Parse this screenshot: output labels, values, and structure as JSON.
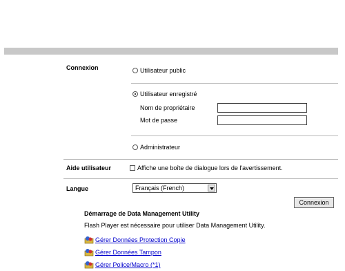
{
  "login": {
    "section_label": "Connexion",
    "public_user_label": "Utilisateur public",
    "registered_user_label": "Utilisateur enregistré",
    "owner_name_label": "Nom de propriétaire",
    "password_label": "Mot de passe",
    "owner_name_value": "",
    "password_value": "",
    "admin_label": "Administrateur",
    "selected": "registered"
  },
  "help": {
    "section_label": "Aide utilisateur",
    "checkbox_label": "Affiche une boîte de dialogue lors de l'avertissement."
  },
  "language": {
    "section_label": "Langue",
    "selected": "Français (French)"
  },
  "connect_button": "Connexion",
  "dmu": {
    "title": "Démarrage de Data Management Utility",
    "note": "Flash Player est nécessaire pour utiliser Data Management Utility.",
    "links": [
      {
        "label": "Gérer Données Protection Copie",
        "icon": "data-management-icon"
      },
      {
        "label": "Gérer Données Tampon",
        "icon": "data-management-icon"
      },
      {
        "label": "Gérer Police/Macro (*1)",
        "icon": "data-management-icon"
      }
    ]
  }
}
